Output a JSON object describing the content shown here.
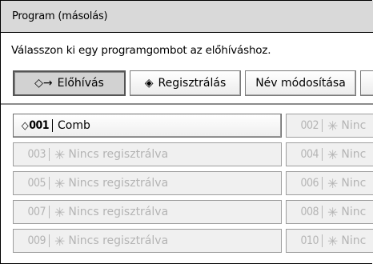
{
  "window": {
    "title": "Program (másolás)"
  },
  "instruction": "Válasszon ki egy programgombot az előhíváshoz.",
  "tabs": [
    {
      "label": "Előhívás",
      "icon": "recall-icon",
      "active": true
    },
    {
      "label": "Regisztrálás",
      "icon": "register-icon",
      "active": false
    },
    {
      "label": "Név módosítása",
      "active": false
    }
  ],
  "programs": [
    {
      "number": "001",
      "name": "Comb",
      "registered": true
    },
    {
      "number": "002",
      "name": "Ninc",
      "registered": false
    },
    {
      "number": "003",
      "name": "Nincs regisztrálva",
      "registered": false
    },
    {
      "number": "004",
      "name": "Ninc",
      "registered": false
    },
    {
      "number": "005",
      "name": "Nincs regisztrálva",
      "registered": false
    },
    {
      "number": "006",
      "name": "Ninc",
      "registered": false
    },
    {
      "number": "007",
      "name": "Nincs regisztrálva",
      "registered": false
    },
    {
      "number": "008",
      "name": "Ninc",
      "registered": false
    },
    {
      "number": "009",
      "name": "Nincs regisztrálva",
      "registered": false
    },
    {
      "number": "010",
      "name": "Ninc",
      "registered": false
    }
  ],
  "icons": {
    "recall": "◇→",
    "register": "◈",
    "unregistered": "✳"
  }
}
